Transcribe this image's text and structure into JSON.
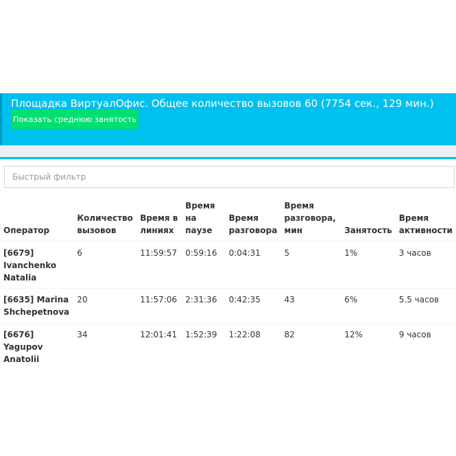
{
  "banner": {
    "title": "Площадка ВиртуалОфис. Общее количество вызовов 60 (7754 сек., 129 мин.)",
    "button_label": "Показать среднюю занятость",
    "color": "#00c0ef",
    "button_color": "#00e070"
  },
  "filter": {
    "placeholder": "Быстрый фильтр",
    "value": ""
  },
  "table": {
    "headers": {
      "operator": "Оператор",
      "calls": "Количество вызовов",
      "time_online": "Время в линиях",
      "time_pause": "Время на паузе",
      "talk_time": "Время разговора",
      "talk_time_min": "Время разговора, мин",
      "occupancy": "Занятость",
      "activity_time": "Время активности"
    },
    "rows": [
      {
        "operator": "[6679] Ivanchenko Natalia",
        "calls": "6",
        "time_online": "11:59:57",
        "time_pause": "0:59:16",
        "talk_time": "0:04:31",
        "talk_time_min": "5",
        "occupancy": "1%",
        "activity_time": "3 часов"
      },
      {
        "operator": "[6635] Marina Shchepetnova",
        "calls": "20",
        "time_online": "11:57:06",
        "time_pause": "2:31:36",
        "talk_time": "0:42:35",
        "talk_time_min": "43",
        "occupancy": "6%",
        "activity_time": "5.5 часов"
      },
      {
        "operator": "[6676] Yagupov Anatolii",
        "calls": "34",
        "time_online": "12:01:41",
        "time_pause": "1:52:39",
        "talk_time": "1:22:08",
        "talk_time_min": "82",
        "occupancy": "12%",
        "activity_time": "9 часов"
      }
    ]
  }
}
